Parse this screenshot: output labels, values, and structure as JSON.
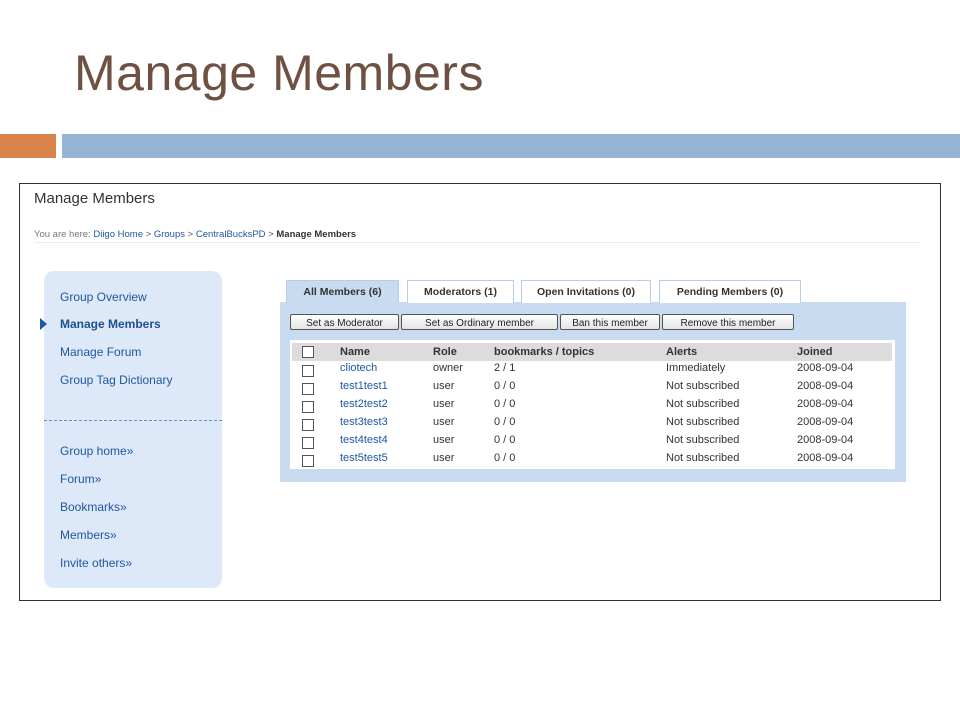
{
  "slide": {
    "title": "Manage Members"
  },
  "page": {
    "heading": "Manage Members",
    "breadcrumb": {
      "prefix": "You are here:",
      "items": [
        "Diigo Home",
        "Groups",
        "CentralBucksPD"
      ],
      "separator": ">",
      "current": "Manage Members"
    }
  },
  "sidebar": {
    "items": [
      {
        "label": "Group Overview"
      },
      {
        "label": "Manage Members"
      },
      {
        "label": "Manage Forum"
      },
      {
        "label": "Group Tag Dictionary"
      }
    ],
    "links": [
      {
        "label": "Group home»"
      },
      {
        "label": "Forum»"
      },
      {
        "label": "Bookmarks»"
      },
      {
        "label": "Members»"
      },
      {
        "label": "Invite others»"
      }
    ]
  },
  "tabs": [
    {
      "label": "All Members (6)"
    },
    {
      "label": "Moderators (1)"
    },
    {
      "label": "Open Invitations (0)"
    },
    {
      "label": "Pending Members (0)"
    }
  ],
  "actions": {
    "set_moderator": "Set as Moderator",
    "set_ordinary": "Set as Ordinary member",
    "ban": "Ban this member",
    "remove": "Remove this member"
  },
  "table": {
    "columns": [
      "Name",
      "Role",
      "bookmarks / topics",
      "Alerts",
      "Joined"
    ],
    "rows": [
      {
        "name": "cliotech",
        "role": "owner",
        "bookmarks": "2 / 1",
        "alerts": "Immediately",
        "joined": "2008-09-04"
      },
      {
        "name": "test1test1",
        "role": "user",
        "bookmarks": "0 / 0",
        "alerts": "Not subscribed",
        "joined": "2008-09-04"
      },
      {
        "name": "test2test2",
        "role": "user",
        "bookmarks": "0 / 0",
        "alerts": "Not subscribed",
        "joined": "2008-09-04"
      },
      {
        "name": "test3test3",
        "role": "user",
        "bookmarks": "0 / 0",
        "alerts": "Not subscribed",
        "joined": "2008-09-04"
      },
      {
        "name": "test4test4",
        "role": "user",
        "bookmarks": "0 / 0",
        "alerts": "Not subscribed",
        "joined": "2008-09-04"
      },
      {
        "name": "test5test5",
        "role": "user",
        "bookmarks": "0 / 0",
        "alerts": "Not subscribed",
        "joined": "2008-09-04"
      }
    ]
  },
  "colors": {
    "title": "#6e5143",
    "accent_orange": "#d9824a",
    "accent_blue": "#96b4d3",
    "link": "#1f57a0",
    "panel": "#c9dbf1",
    "sidebar": "#dde9f8"
  }
}
